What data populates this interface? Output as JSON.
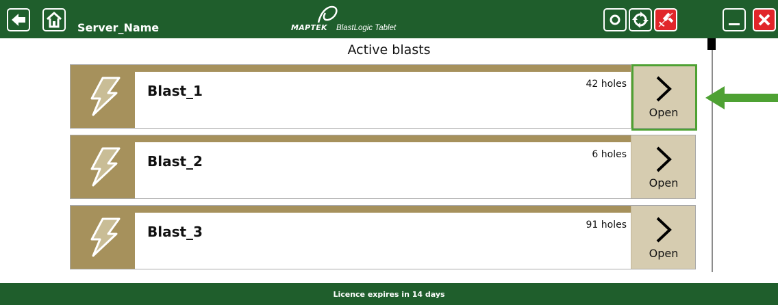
{
  "header": {
    "server_name": "Server_Name",
    "logo_brand": "MAPTEK",
    "logo_product": "BlastLogic Tablet",
    "icons": {
      "back": "back-arrow-icon",
      "home": "home-icon",
      "refresh": "refresh-icon",
      "sync": "sync-icon",
      "gps": "satellite-disconnected-icon",
      "minimize": "minimize-icon",
      "close": "close-icon"
    }
  },
  "main": {
    "title": "Active blasts",
    "blasts": [
      {
        "name": "Blast_1",
        "holes": "42 holes",
        "open_label": "Open"
      },
      {
        "name": "Blast_2",
        "holes": "6 holes",
        "open_label": "Open"
      },
      {
        "name": "Blast_3",
        "holes": "91 holes",
        "open_label": "Open"
      }
    ]
  },
  "footer": {
    "licence_text": "Licence expires in 14 days"
  },
  "colors": {
    "header_green": "#1f5e2c",
    "card_gold": "#a6915c",
    "open_button": "#d6ccb0",
    "highlight_green": "#4ea133",
    "close_red": "#e1262a"
  }
}
